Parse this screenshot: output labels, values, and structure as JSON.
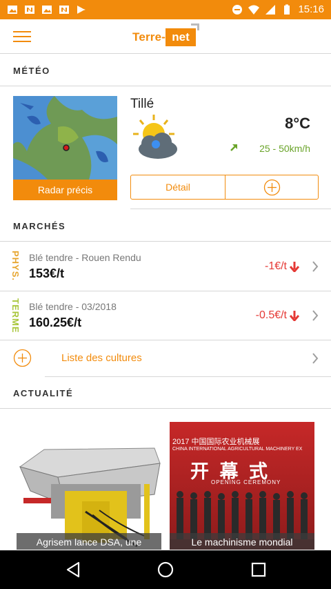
{
  "status_bar": {
    "time": "15:16",
    "left_icons": [
      "image-icon",
      "news-icon",
      "image-icon",
      "news-icon",
      "play-store-icon"
    ],
    "right_icons": [
      "dnd-icon",
      "wifi-icon",
      "signal-icon",
      "battery-icon"
    ]
  },
  "app_bar": {
    "logo_text_left": "Terre-",
    "logo_text_box": "net",
    "menu_icon": "hamburger-icon"
  },
  "meteo": {
    "section_title": "MÉTÉO",
    "radar_button": "Radar précis",
    "city": "Tillé",
    "temperature": "8°C",
    "wind": "25 - 50km/h",
    "wind_icon": "arrow-up-right-icon",
    "weather_icon": "sun-cloud-rain-icon",
    "detail_button": "Détail",
    "add_icon": "plus-circle-icon"
  },
  "marches": {
    "section_title": "MARCHÉS",
    "rows": [
      {
        "tag": "PHYS.",
        "name": "Blé tendre - Rouen Rendu",
        "price": "153€/t",
        "change": "-1€/t"
      },
      {
        "tag": "TERME",
        "name": "Blé tendre - 03/2018",
        "price": "160.25€/t",
        "change": "-0.5€/t"
      }
    ],
    "cultures_label": "Liste des cultures"
  },
  "actualite": {
    "section_title": "ACTUALITÉ",
    "articles": [
      {
        "caption": "Agrisem lance DSA, une"
      },
      {
        "caption": "Le machinisme mondial"
      }
    ],
    "banner_text": "2017 中国国际农业机械展",
    "banner_sub": "CHINA INTERNATIONAL AGRICULTURAL MACHINERY EX",
    "banner_big": "开 幕 式",
    "banner_en": "OPENING CEREMONY"
  },
  "colors": {
    "accent": "#f28b0c",
    "down": "#e53935",
    "wind": "#6aa42a",
    "terme": "#a8c63a",
    "phys": "#e7a62f"
  }
}
